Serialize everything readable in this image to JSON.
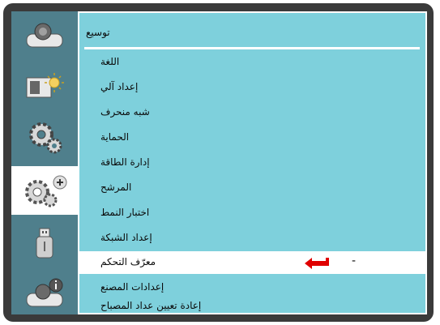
{
  "sidebar": {
    "items": [
      {
        "icon": "projector-icon"
      },
      {
        "icon": "picture-brightness-icon"
      },
      {
        "icon": "settings-gears-icon"
      },
      {
        "icon": "extended-settings-gears-plus-icon",
        "active": true
      },
      {
        "icon": "usb-drive-icon"
      },
      {
        "icon": "projector-info-icon"
      }
    ]
  },
  "menu": {
    "title": "توسيع",
    "items": [
      {
        "label": "اللغة"
      },
      {
        "label": "إعداد آلي"
      },
      {
        "label": "شبه منحرف"
      },
      {
        "label": "الحماية"
      },
      {
        "label": "إدارة الطاقة"
      },
      {
        "label": "المرشح"
      },
      {
        "label": "اختبار النمط"
      },
      {
        "label": "إعداد الشبكة"
      },
      {
        "label": "معرّف التحكم",
        "selected": true,
        "value": "-"
      },
      {
        "label": "إعدادات المصنع"
      },
      {
        "label": "إعادة تعيين عداد المصباح"
      }
    ]
  },
  "colors": {
    "frame": "#3a3a3a",
    "sidebar": "#4f7f8c",
    "panel": "#7ed0dc",
    "selected_row": "#ffffff",
    "enter_arrow": "#e00000"
  }
}
